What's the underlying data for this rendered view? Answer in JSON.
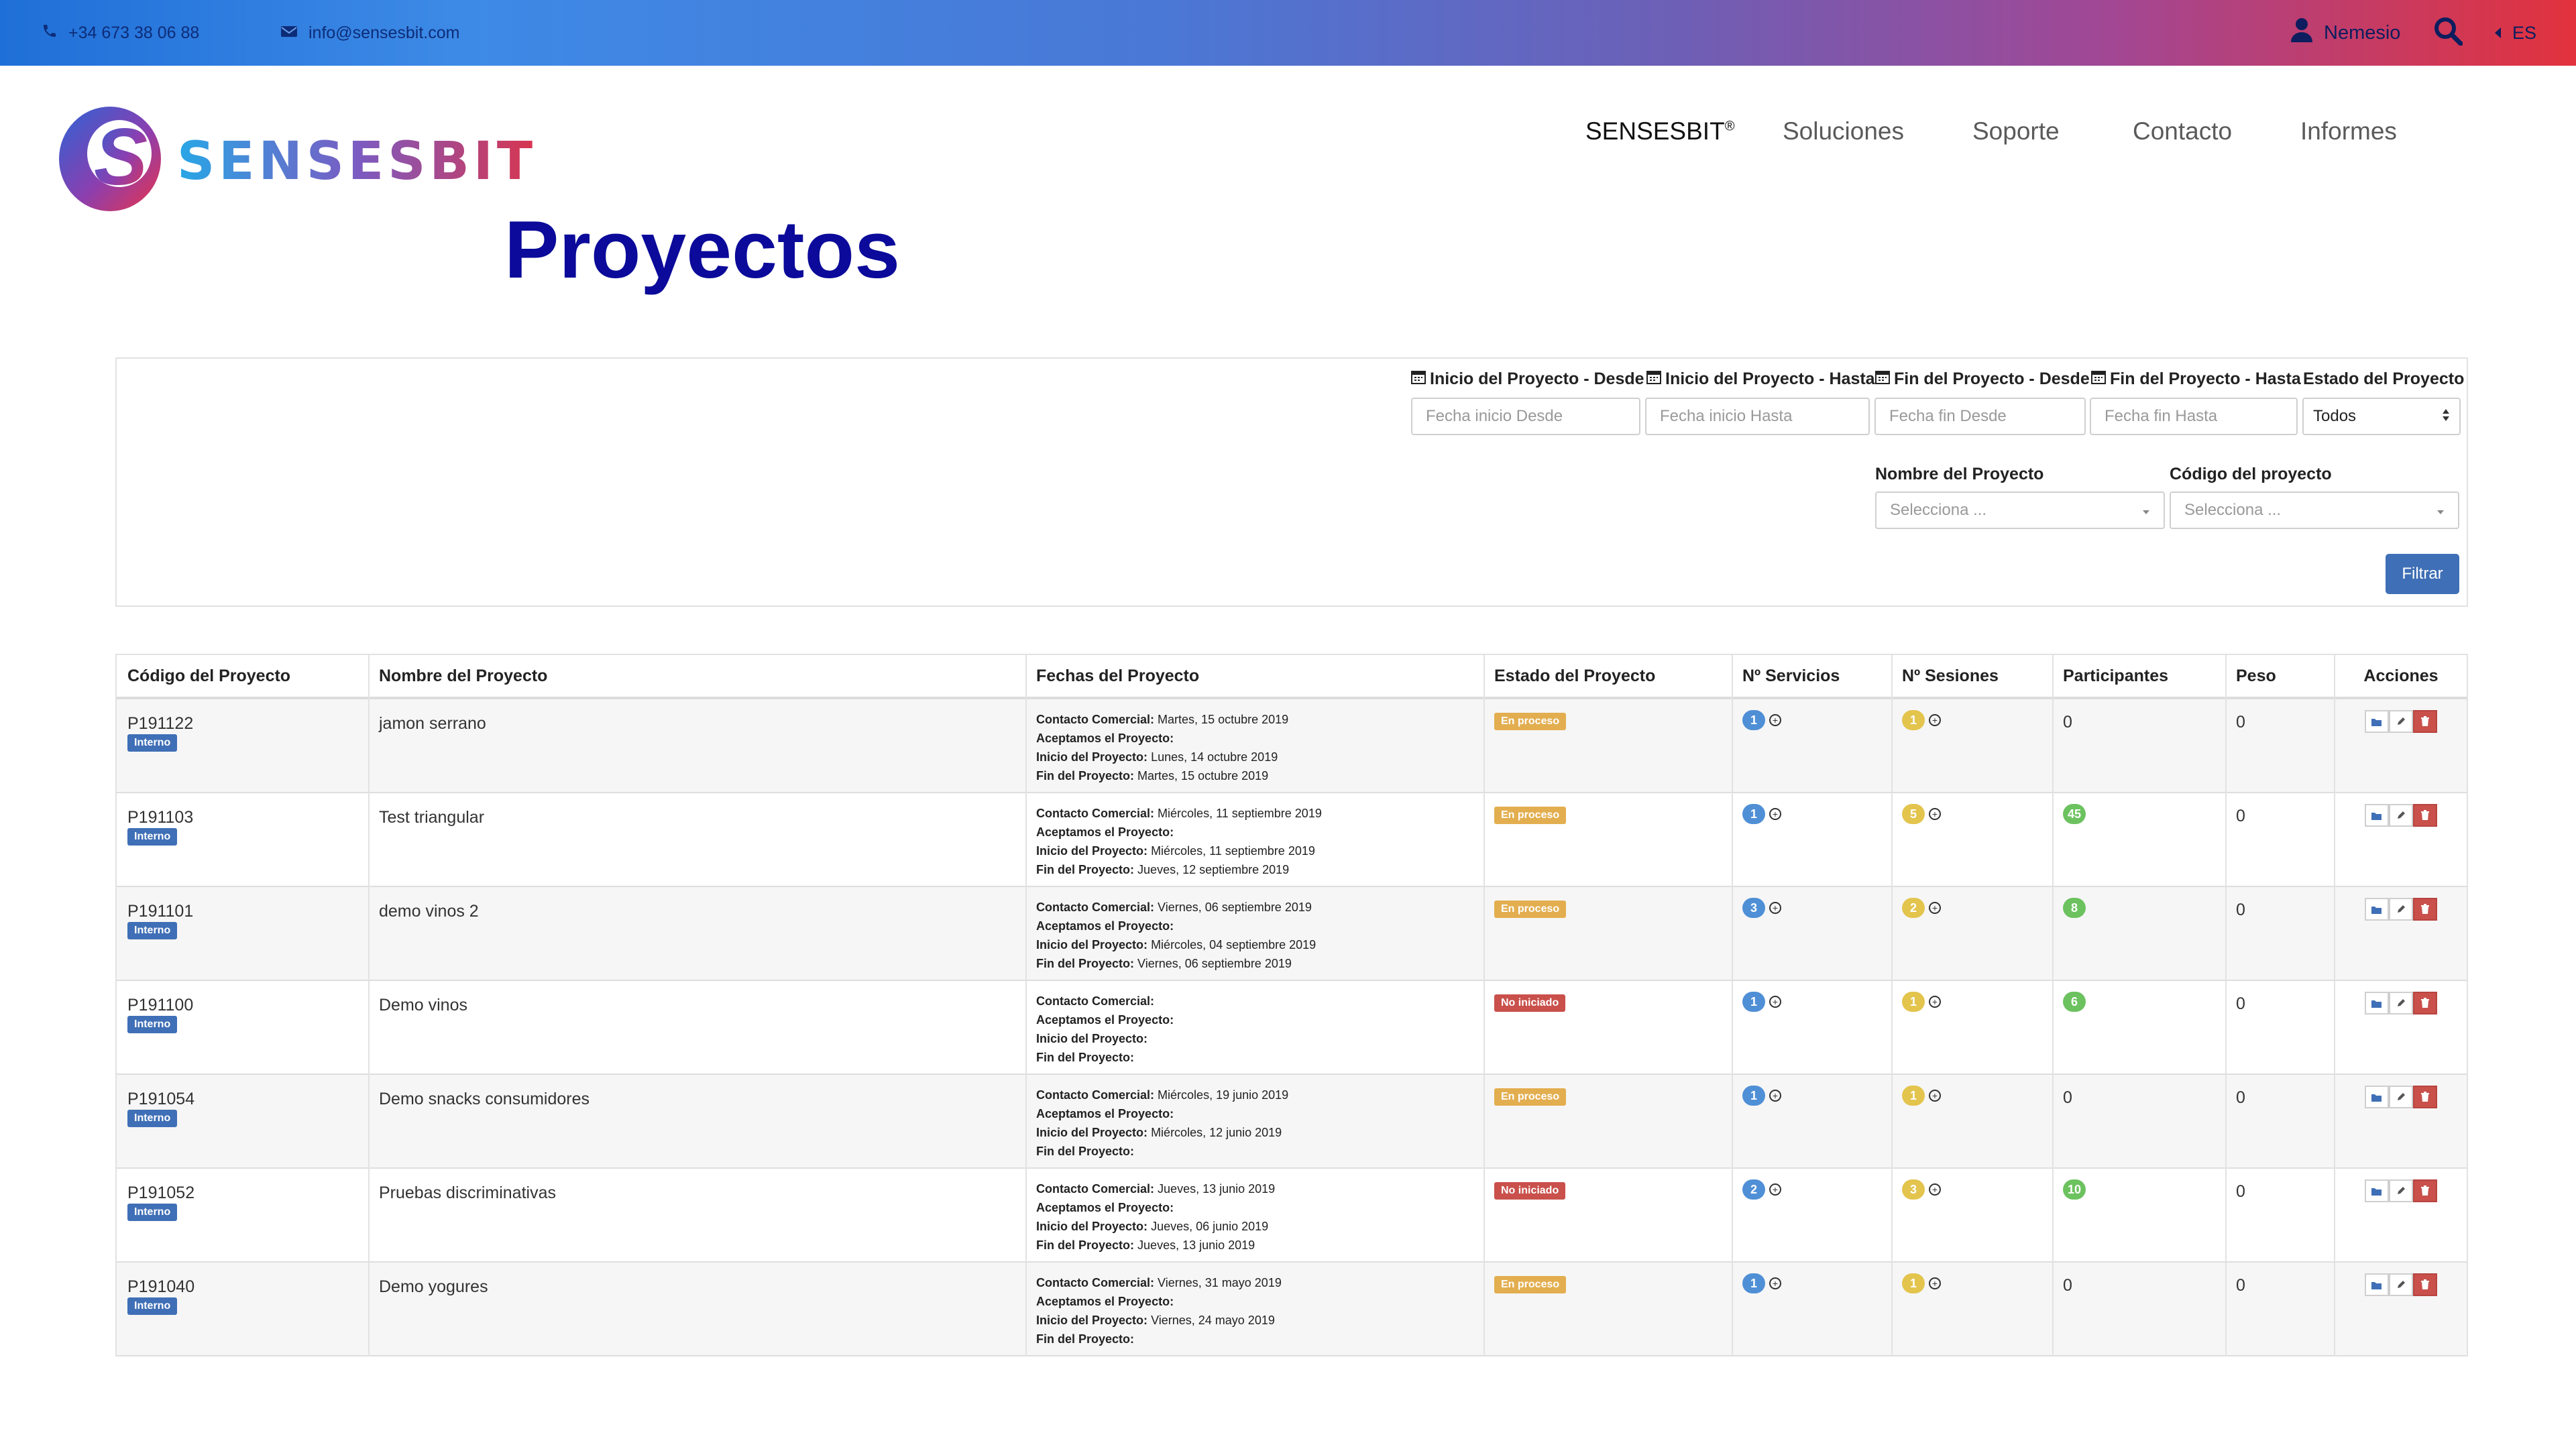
{
  "topbar": {
    "phone": "+34 673 38 06 88",
    "email": "info@sensesbit.com",
    "user": "Nemesio",
    "lang": "ES"
  },
  "brand": {
    "name": "SENSESBIT",
    "icon_letter": "S"
  },
  "nav": {
    "items": [
      {
        "label": "SENSESBIT",
        "sup": "®"
      },
      {
        "label": "Soluciones"
      },
      {
        "label": "Soporte"
      },
      {
        "label": "Contacto"
      },
      {
        "label": "Informes"
      }
    ]
  },
  "page_title": "Proyectos",
  "filters": {
    "labels": {
      "inicio_desde": "Inicio del Proyecto - Desde",
      "inicio_hasta": "Inicio del Proyecto - Hasta",
      "fin_desde": "Fin del Proyecto - Desde",
      "fin_hasta": "Fin del Proyecto - Hasta",
      "estado": "Estado del Proyecto",
      "nombre": "Nombre del Proyecto",
      "codigo": "Código del proyecto"
    },
    "placeholders": {
      "inicio_desde": "Fecha inicio Desde",
      "inicio_hasta": "Fecha inicio Hasta",
      "fin_desde": "Fecha fin Desde",
      "fin_hasta": "Fecha fin Hasta",
      "nombre": "Selecciona ...",
      "codigo": "Selecciona ..."
    },
    "estado_value": "Todos",
    "button": "Filtrar"
  },
  "table": {
    "headers": [
      "Código del Proyecto",
      "Nombre del Proyecto",
      "Fechas del Proyecto",
      "Estado del Proyecto",
      "Nº Servicios",
      "Nº Sesiones",
      "Participantes",
      "Peso",
      "Acciones"
    ],
    "date_labels": {
      "comercial": "Contacto Comercial:",
      "aceptamos": "Aceptamos el Proyecto:",
      "inicio": "Inicio del Proyecto:",
      "fin": "Fin del Proyecto:"
    },
    "rows": [
      {
        "code": "P191122",
        "tag": "Interno",
        "name": "jamon serrano",
        "comercial": "Martes, 15 octubre 2019",
        "aceptamos": "",
        "inicio": "Lunes, 14 octubre 2019",
        "fin": "Martes, 15 octubre 2019",
        "status": "En proceso",
        "servicios": "1",
        "sesiones": "1",
        "participantes": "0",
        "peso": "0"
      },
      {
        "code": "P191103",
        "tag": "Interno",
        "name": "Test triangular",
        "comercial": "Miércoles, 11 septiembre 2019",
        "aceptamos": "",
        "inicio": "Miércoles, 11 septiembre 2019",
        "fin": "Jueves, 12 septiembre 2019",
        "status": "En proceso",
        "servicios": "1",
        "sesiones": "5",
        "participantes": "45",
        "peso": "0"
      },
      {
        "code": "P191101",
        "tag": "Interno",
        "name": "demo vinos 2",
        "comercial": "Viernes, 06 septiembre 2019",
        "aceptamos": "",
        "inicio": "Miércoles, 04 septiembre 2019",
        "fin": "Viernes, 06 septiembre 2019",
        "status": "En proceso",
        "servicios": "3",
        "sesiones": "2",
        "participantes": "8",
        "peso": "0"
      },
      {
        "code": "P191100",
        "tag": "Interno",
        "name": "Demo vinos",
        "comercial": "",
        "aceptamos": "",
        "inicio": "",
        "fin": "",
        "status": "No iniciado",
        "servicios": "1",
        "sesiones": "1",
        "participantes": "6",
        "peso": "0"
      },
      {
        "code": "P191054",
        "tag": "Interno",
        "name": "Demo snacks consumidores",
        "comercial": "Miércoles, 19 junio 2019",
        "aceptamos": "",
        "inicio": "Miércoles, 12 junio 2019",
        "fin": "",
        "status": "En proceso",
        "servicios": "1",
        "sesiones": "1",
        "participantes": "0",
        "peso": "0"
      },
      {
        "code": "P191052",
        "tag": "Interno",
        "name": "Pruebas discriminativas",
        "comercial": "Jueves, 13 junio 2019",
        "aceptamos": "",
        "inicio": "Jueves, 06 junio 2019",
        "fin": "Jueves, 13 junio 2019",
        "status": "No iniciado",
        "servicios": "2",
        "sesiones": "3",
        "participantes": "10",
        "peso": "0"
      },
      {
        "code": "P191040",
        "tag": "Interno",
        "name": "Demo yogures",
        "comercial": "Viernes, 31 mayo 2019",
        "aceptamos": "",
        "inicio": "Viernes, 24 mayo 2019",
        "fin": "",
        "status": "En proceso",
        "servicios": "1",
        "sesiones": "1",
        "participantes": "0",
        "peso": "0"
      }
    ]
  },
  "colors": {
    "title": "#0b0a9a",
    "internal_tag": "#3f6fb6",
    "status_proceso": "#e3ae4f",
    "status_no_iniciado": "#c9504b",
    "pill_servicios": "#4f8fd6",
    "pill_sesiones": "#e3c44d",
    "pill_participantes": "#6cc25f"
  },
  "icons": {
    "phone": "phone-icon",
    "mail": "envelope-icon",
    "user": "user-icon",
    "search": "search-icon",
    "lang": "caret-left-icon",
    "calendar": "calendar-icon",
    "actions": [
      "folder-open-icon",
      "pencil-icon",
      "trash-icon"
    ]
  }
}
